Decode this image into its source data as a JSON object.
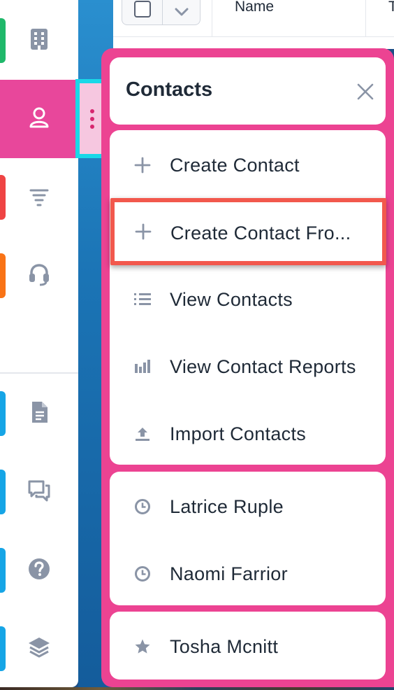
{
  "table": {
    "columns": [
      "Name",
      "T"
    ]
  },
  "sidebar": {
    "items": [
      {
        "name": "accounts",
        "icon": "building-icon",
        "accent": "#1fb86a",
        "active": false
      },
      {
        "name": "contacts",
        "icon": "person-icon",
        "accent": "#e8479b",
        "active": true
      },
      {
        "name": "leads",
        "icon": "filter-icon",
        "accent": "#ef4444",
        "active": false
      },
      {
        "name": "cases",
        "icon": "headset-icon",
        "accent": "#f97316",
        "active": false
      },
      {
        "name": "documents",
        "icon": "document-icon",
        "accent": "#16a5e6",
        "active": false
      },
      {
        "name": "forums",
        "icon": "chat-icon",
        "accent": "#16a5e6",
        "active": false
      },
      {
        "name": "help",
        "icon": "help-icon",
        "accent": "#16a5e6",
        "active": false
      },
      {
        "name": "layers",
        "icon": "layers-icon",
        "accent": "#16a5e6",
        "active": false
      }
    ]
  },
  "menu": {
    "title": "Contacts",
    "actions": [
      {
        "icon": "plus-icon",
        "label": "Create Contact"
      },
      {
        "icon": "plus-icon",
        "label": "Create Contact Fro..."
      },
      {
        "icon": "list-icon",
        "label": "View Contacts"
      },
      {
        "icon": "bar-chart-icon",
        "label": "View Contact Reports"
      },
      {
        "icon": "upload-icon",
        "label": "Import Contacts"
      }
    ],
    "recent": [
      {
        "icon": "clock-icon",
        "label": "Latrice Ruple"
      },
      {
        "icon": "clock-icon",
        "label": "Naomi Farrior"
      }
    ],
    "favorites": [
      {
        "icon": "star-icon",
        "label": "Tosha Mcnitt"
      }
    ]
  },
  "colors": {
    "menu_accent": "#ec4392",
    "highlight_border": "#f2584d",
    "handle_border": "#19d8e8",
    "icon_gray": "#8a94a6"
  }
}
